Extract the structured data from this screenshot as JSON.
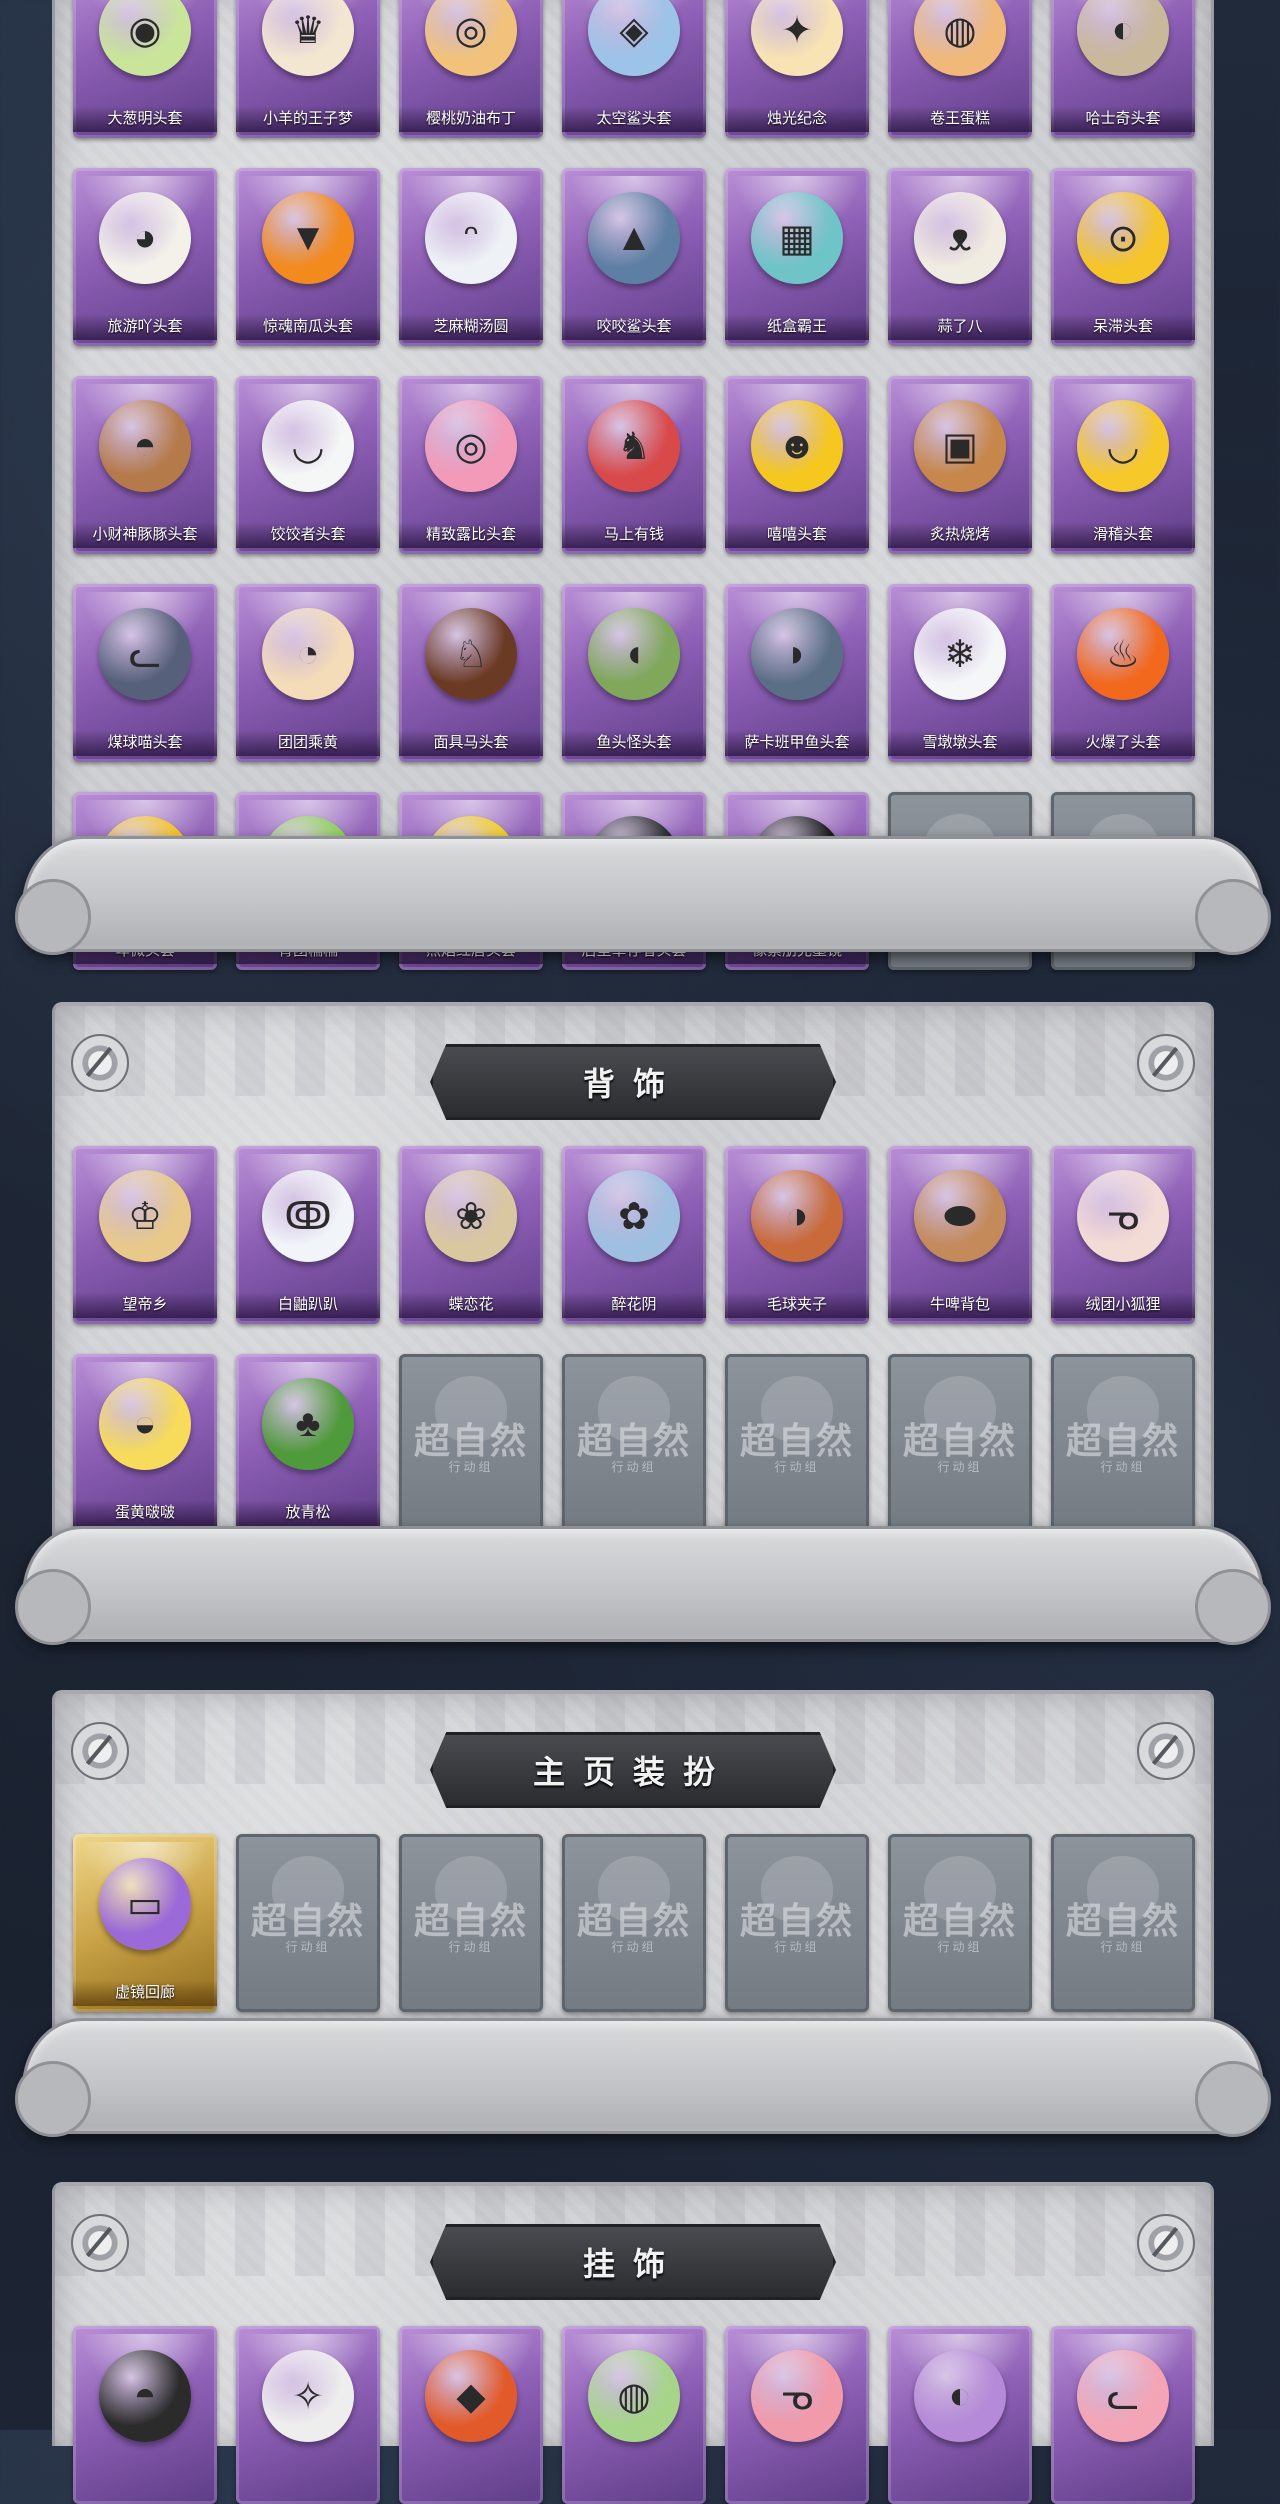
{
  "sections": [
    {
      "id": "hats",
      "title": "",
      "rows": [
        [
          {
            "label": "大葱明头套",
            "icon": "scallion-hat-icon",
            "color": "#c9e59a",
            "glyph": "◉"
          },
          {
            "label": "小羊的王子梦",
            "icon": "lamb-crown-icon",
            "color": "#f3e7d2",
            "glyph": "♛"
          },
          {
            "label": "樱桃奶油布丁",
            "icon": "pudding-icon",
            "color": "#f2c27a",
            "glyph": "◎"
          },
          {
            "label": "太空鲨头套",
            "icon": "space-shark-icon",
            "color": "#9cc3e8",
            "glyph": "◈"
          },
          {
            "label": "烛光纪念",
            "icon": "candle-icon",
            "color": "#f7e3b3",
            "glyph": "✦"
          },
          {
            "label": "卷王蛋糕",
            "icon": "cake-icon",
            "color": "#f0b97a",
            "glyph": "◍"
          },
          {
            "label": "哈士奇头套",
            "icon": "husky-icon",
            "color": "#c9b89a",
            "glyph": "◐"
          }
        ],
        [
          {
            "label": "旅游吖头套",
            "icon": "duck-tourist-icon",
            "color": "#f3f1ea",
            "glyph": "◕"
          },
          {
            "label": "惊魂南瓜头套",
            "icon": "pumpkin-icon",
            "color": "#f28a1e",
            "glyph": "▼"
          },
          {
            "label": "芝麻糊汤圆",
            "icon": "tangyuan-icon",
            "color": "#eef2f6",
            "glyph": "ᵔ"
          },
          {
            "label": "咬咬鲨头套",
            "icon": "shark-icon",
            "color": "#5d7fa3",
            "glyph": "▲"
          },
          {
            "label": "纸盒霸王",
            "icon": "box-dino-icon",
            "color": "#6fc4c8",
            "glyph": "▦"
          },
          {
            "label": "蒜了八",
            "icon": "garlic-icon",
            "color": "#f1ece1",
            "glyph": "ᴥ"
          },
          {
            "label": "呆滞头套",
            "icon": "dazed-face-icon",
            "color": "#f5c52a",
            "glyph": "⊙"
          }
        ],
        [
          {
            "label": "小财神豚豚头套",
            "icon": "capybara-icon",
            "color": "#b57a4a",
            "glyph": "◓"
          },
          {
            "label": "饺饺者头套",
            "icon": "dumpling-icon",
            "color": "#f5f7f6",
            "glyph": "◡"
          },
          {
            "label": "精致露比头套",
            "icon": "pink-beaver-icon",
            "color": "#f29ab8",
            "glyph": "◎"
          },
          {
            "label": "马上有钱",
            "icon": "red-horse-icon",
            "color": "#d84a4a",
            "glyph": "♞"
          },
          {
            "label": "嘻嘻头套",
            "icon": "grin-face-icon",
            "color": "#f6c71e",
            "glyph": "☻"
          },
          {
            "label": "炙热烧烤",
            "icon": "bbq-icon",
            "color": "#c7874a",
            "glyph": "▣"
          },
          {
            "label": "滑稽头套",
            "icon": "smirk-face-icon",
            "color": "#f7c82a",
            "glyph": "◡"
          }
        ],
        [
          {
            "label": "煤球喵头套",
            "icon": "cat-icon",
            "color": "#56607a",
            "glyph": "ᓚ"
          },
          {
            "label": "团团乘黄",
            "icon": "cream-beast-icon",
            "color": "#f4dcb8",
            "glyph": "◔"
          },
          {
            "label": "面具马头套",
            "icon": "horse-mask-icon",
            "color": "#6b3a24",
            "glyph": "♘"
          },
          {
            "label": "鱼头怪头套",
            "icon": "fish-head-icon",
            "color": "#7fa85a",
            "glyph": "◖"
          },
          {
            "label": "萨卡班甲鱼头套",
            "icon": "fish-icon",
            "color": "#5a6f86",
            "glyph": "◗"
          },
          {
            "label": "雪墩墩头套",
            "icon": "snowman-icon",
            "color": "#f4f6f8",
            "glyph": "❄"
          },
          {
            "label": "火爆了头套",
            "icon": "fire-icon",
            "color": "#f2691e",
            "glyph": "♨"
          }
        ],
        [
          {
            "label": "卑微头套",
            "icon": "shy-face-icon",
            "color": "#f6c72a",
            "glyph": "◠"
          },
          {
            "label": "青团糯糯",
            "icon": "green-mochi-icon",
            "color": "#8fd25a",
            "glyph": "ᵕ"
          },
          {
            "label": "烈焰红唇头套",
            "icon": "yellow-creature-icon",
            "color": "#f3d12a",
            "glyph": "▾"
          },
          {
            "label": "后室幸存者头套",
            "icon": "gas-mask-icon",
            "color": "#2c2f33",
            "glyph": "◉"
          },
          {
            "label": "像素朋克墨镜",
            "icon": "pixel-sunglasses-icon",
            "color": "#1c1c1c",
            "glyph": "▬"
          },
          {
            "locked": true
          },
          {
            "locked": true
          }
        ]
      ]
    },
    {
      "id": "back",
      "title": "背饰",
      "rows": [
        [
          {
            "label": "望帝乡",
            "icon": "character-icon",
            "color": "#e8c98a",
            "glyph": "♔"
          },
          {
            "label": "白鼬趴趴",
            "icon": "ermine-icon",
            "color": "#f1f4f8",
            "glyph": "ↂ"
          },
          {
            "label": "蝶恋花",
            "icon": "butterfly-ring-icon",
            "color": "#d9c7a0",
            "glyph": "❀"
          },
          {
            "label": "醉花阴",
            "icon": "flower-ring-icon",
            "color": "#9fbfe0",
            "glyph": "✿"
          },
          {
            "label": "毛球夹子",
            "icon": "raccoon-icon",
            "color": "#c86a3a",
            "glyph": "◑"
          },
          {
            "label": "牛啤背包",
            "icon": "cow-barrel-icon",
            "color": "#c48a5a",
            "glyph": "⬬"
          },
          {
            "label": "绒团小狐狸",
            "icon": "fox-icon",
            "color": "#f4dcd6",
            "glyph": "ᓀ"
          }
        ],
        [
          {
            "label": "蛋黄啵啵",
            "icon": "chick-egg-icon",
            "color": "#f7db5a",
            "glyph": "◒"
          },
          {
            "label": "放青松",
            "icon": "bonsai-icon",
            "color": "#4f9a3a",
            "glyph": "♣"
          },
          {
            "locked": true
          },
          {
            "locked": true
          },
          {
            "locked": true
          },
          {
            "locked": true
          },
          {
            "locked": true
          }
        ]
      ]
    },
    {
      "id": "homepage",
      "title": "主页装扮",
      "rows": [
        [
          {
            "label": "虚镜回廊",
            "icon": "purple-card-icon",
            "color": "#9b6ad8",
            "glyph": "▭",
            "gold": true
          },
          {
            "locked": true
          },
          {
            "locked": true
          },
          {
            "locked": true
          },
          {
            "locked": true
          },
          {
            "locked": true
          },
          {
            "locked": true
          }
        ]
      ]
    },
    {
      "id": "pendant",
      "title": "挂饰",
      "rows": [
        [
          {
            "label": "",
            "icon": "chibi-pendant-icon",
            "color": "#2b2b2b",
            "glyph": "◓"
          },
          {
            "label": "",
            "icon": "white-tassel-icon",
            "color": "#eeeeee",
            "glyph": "✧"
          },
          {
            "label": "",
            "icon": "lantern-icon",
            "color": "#e25a2a",
            "glyph": "◆"
          },
          {
            "label": "",
            "icon": "green-bag-icon",
            "color": "#a6d58a",
            "glyph": "◍"
          },
          {
            "label": "",
            "icon": "pink-fox-icon",
            "color": "#f19aaa",
            "glyph": "ᓀ"
          },
          {
            "label": "",
            "icon": "purple-hair-girl-icon",
            "color": "#b58ad8",
            "glyph": "◐"
          },
          {
            "label": "",
            "icon": "pink-cat-icon",
            "color": "#f4a5b5",
            "glyph": "ᓚ"
          }
        ]
      ]
    }
  ],
  "locked_stamp": {
    "text": "超自然",
    "subtext": "行动组"
  },
  "colors": {
    "accent_purple": "#8d5fb5",
    "panel": "#cfd0d3",
    "banner": "#2b2c30"
  }
}
